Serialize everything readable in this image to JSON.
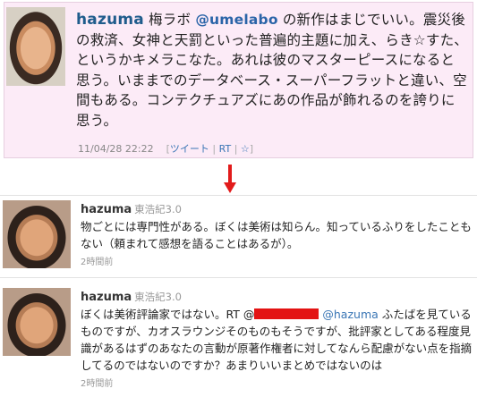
{
  "top_tweet": {
    "username": "hazuma",
    "text_before_mention": "梅ラボ",
    "mention": "@umelabo",
    "text": "の新作はまじでいい。震災後の救済、女神と天罰といった普遍的主題に加え、らき☆すた、というかキメラこなた。あれは彼のマスターピースになると思う。いままでのデータベース・スーパーフラットと違い、空間もある。コンテクチュアズにあの作品が飾れるのを誇りに思う。",
    "timestamp": "11/04/28 22:22",
    "action_tweet": "ツイート",
    "action_rt": "RT",
    "action_star": "☆"
  },
  "tweets": [
    {
      "username": "hazuma",
      "fullname": "東浩紀3.0",
      "text": "物ごとには専門性がある。ぼくは美術は知らん。知っているふりをしたこともない（頼まれて感想を語ることはあるが）。",
      "time": "2時間前"
    },
    {
      "username": "hazuma",
      "fullname": "東浩紀3.0",
      "text_before": "ぼくは美術評論家ではない。RT @",
      "mention": "@hazuma",
      "text_after": "ふたばを見ているものですが、カオスラウンジそのものもそうですが、批評家としてある程度見識があるはずのあなたの言動が原著作権者に対してなんら配慮がない点を指摘してるのではないのですか？あまりいいまとめではないのは",
      "time": "2時間前"
    }
  ]
}
